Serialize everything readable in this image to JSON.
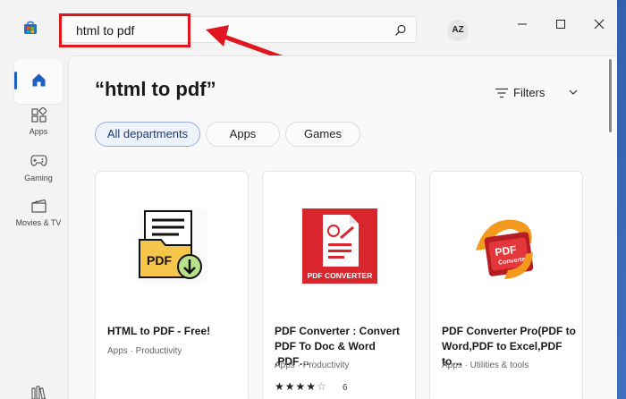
{
  "window": {
    "search_query": "html to pdf",
    "avatar_initials": "AZ"
  },
  "sidebar": {
    "items": [
      {
        "label": "",
        "icon": "home-icon"
      },
      {
        "label": "Apps",
        "icon": "apps-icon"
      },
      {
        "label": "Gaming",
        "icon": "gamepad-icon"
      },
      {
        "label": "Movies & TV",
        "icon": "clapperboard-icon"
      }
    ]
  },
  "main": {
    "title": "“html to pdf”",
    "filters_label": "Filters",
    "departments": [
      "All departments",
      "Apps",
      "Games"
    ],
    "selected_department": "All departments"
  },
  "results": [
    {
      "title": "HTML to PDF - Free!",
      "meta": "Apps · Productivity",
      "icon": "html-to-pdf-folder-icon"
    },
    {
      "title": "PDF Converter : Convert PDF To Doc & Word ,PDF…",
      "meta": "Apps · Productivity",
      "rating": 4,
      "rating_count": "6",
      "icon_text": "PDF CONVERTER",
      "icon": "pdf-converter-icon"
    },
    {
      "title": "PDF Converter Pro(PDF to Word,PDF to Excel,PDF to…",
      "meta": "Apps · Utilities & tools",
      "icon_text_top": "PDF",
      "icon_text_bottom": "Converter",
      "icon": "pdf-converter-pro-icon"
    }
  ],
  "colors": {
    "accent": "#1f5fbf",
    "annotation": "#e0161e"
  }
}
